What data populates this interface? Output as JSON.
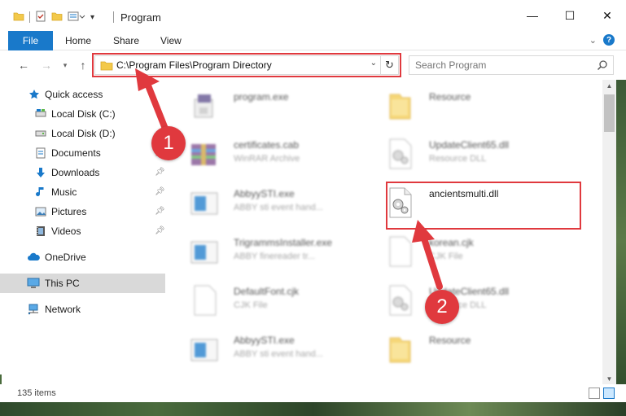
{
  "window": {
    "title": "Program"
  },
  "ribbon": {
    "file_tab": "File",
    "tabs": [
      "Home",
      "Share",
      "View"
    ]
  },
  "address_bar": {
    "path": "C:\\Program Files\\Program Directory"
  },
  "search": {
    "placeholder": "Search Program"
  },
  "sidebar": {
    "quick_access": "Quick access",
    "items": [
      {
        "label": "Local Disk (C:)",
        "icon": "drive-icon",
        "pinned": false
      },
      {
        "label": "Local Disk (D:)",
        "icon": "drive-icon",
        "pinned": false
      },
      {
        "label": "Documents",
        "icon": "documents-icon",
        "pinned": true
      },
      {
        "label": "Downloads",
        "icon": "downloads-icon",
        "pinned": true
      },
      {
        "label": "Music",
        "icon": "music-icon",
        "pinned": true
      },
      {
        "label": "Pictures",
        "icon": "pictures-icon",
        "pinned": true
      },
      {
        "label": "Videos",
        "icon": "videos-icon",
        "pinned": true
      }
    ],
    "onedrive": "OneDrive",
    "this_pc": "This PC",
    "network": "Network"
  },
  "files": [
    {
      "name": "program.exe",
      "type": "",
      "icon": "exe-icon"
    },
    {
      "name": "Resource",
      "type": "",
      "icon": "folder-icon"
    },
    {
      "name": "certificates.cab",
      "type": "WinRAR Archive",
      "icon": "archive-icon"
    },
    {
      "name": "UpdateClient65.dll",
      "type": "Resource DLL",
      "icon": "dll-icon"
    },
    {
      "name": "AbbyySTI.exe",
      "type": "ABBY sti event hand...",
      "icon": "app-icon"
    },
    {
      "name": "ancientsmulti.dll",
      "type": "",
      "icon": "dll-icon"
    },
    {
      "name": "TrigrammsInstaller.exe",
      "type": "ABBY finereader tr...",
      "icon": "app-icon"
    },
    {
      "name": "korean.cjk",
      "type": "CJK File",
      "icon": "file-icon"
    },
    {
      "name": "DefaultFont.cjk",
      "type": "CJK File",
      "icon": "file-icon"
    },
    {
      "name": "UpdateClient65.dll",
      "type": "Resource DLL",
      "icon": "dll-icon"
    },
    {
      "name": "AbbyySTI.exe",
      "type": "ABBY sti event hand...",
      "icon": "app-icon"
    },
    {
      "name": "Resource",
      "type": "",
      "icon": "folder-icon"
    }
  ],
  "status": {
    "item_count": "135 items"
  },
  "callouts": [
    "1",
    "2"
  ],
  "colors": {
    "accent": "#1979ca",
    "highlight": "#e0393e",
    "folder": "#f3c94b"
  }
}
